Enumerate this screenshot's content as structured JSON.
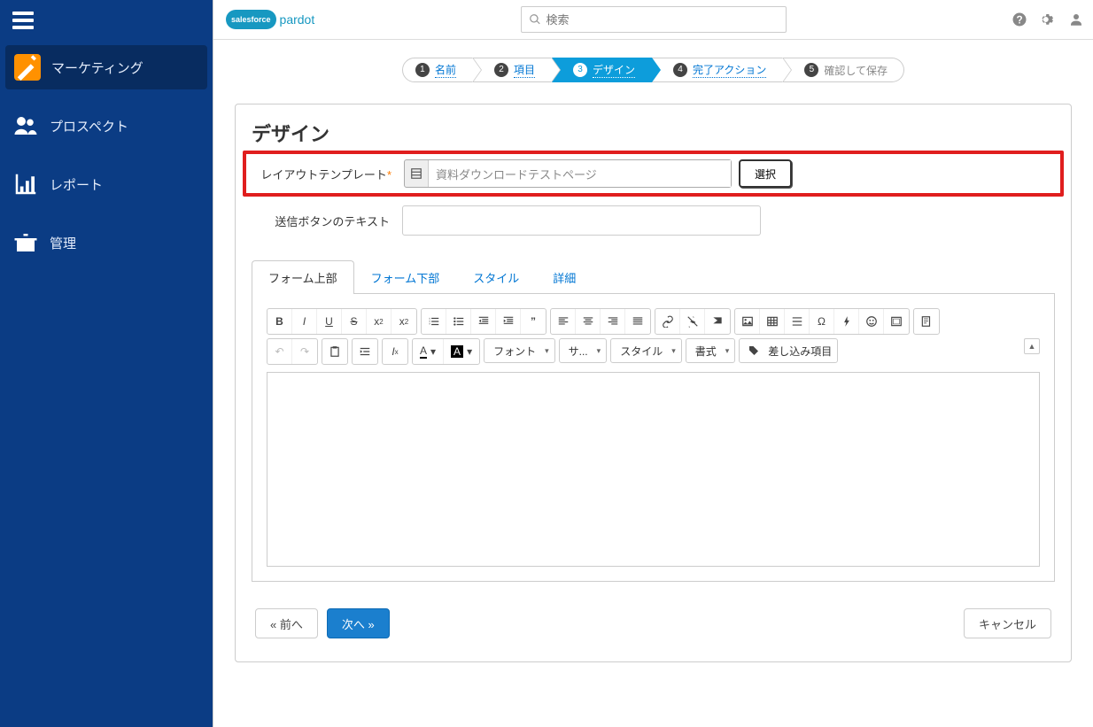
{
  "logo": {
    "cloud": "salesforce",
    "product": "pardot"
  },
  "search": {
    "placeholder": "検索"
  },
  "sidebar": {
    "items": [
      {
        "label": "マーケティング"
      },
      {
        "label": "プロスペクト"
      },
      {
        "label": "レポート"
      },
      {
        "label": "管理"
      }
    ]
  },
  "wizard": {
    "steps": [
      {
        "num": "1",
        "label": "名前"
      },
      {
        "num": "2",
        "label": "項目"
      },
      {
        "num": "3",
        "label": "デザイン"
      },
      {
        "num": "4",
        "label": "完了アクション"
      },
      {
        "num": "5",
        "label": "確認して保存"
      }
    ]
  },
  "page": {
    "title": "デザイン",
    "layout_label": "レイアウトテンプレート",
    "layout_value": "資料ダウンロードテストページ",
    "select_btn": "選択",
    "submit_text_label": "送信ボタンのテキスト",
    "submit_text_value": ""
  },
  "tabs": [
    {
      "label": "フォーム上部"
    },
    {
      "label": "フォーム下部"
    },
    {
      "label": "スタイル"
    },
    {
      "label": "詳細"
    }
  ],
  "toolbar": {
    "font_dd": "フォント",
    "size_dd": "サ...",
    "style_dd": "スタイル",
    "format_dd": "書式",
    "merge_field": "差し込み項目",
    "letter_a": "A"
  },
  "footer": {
    "prev": "« 前へ",
    "next": "次へ »",
    "cancel": "キャンセル"
  }
}
